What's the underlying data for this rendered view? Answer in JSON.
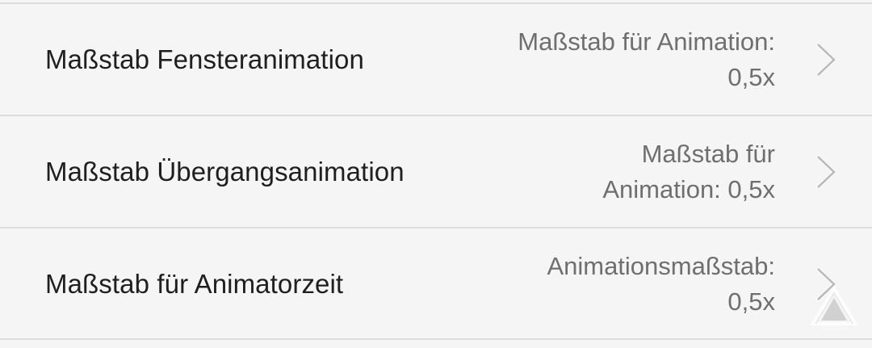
{
  "settings": {
    "items": [
      {
        "title": "Maßstab Fensteranimation",
        "summary_line1": "Maßstab für Animation:",
        "summary_line2": "0,5x"
      },
      {
        "title": "Maßstab Übergangsanimation",
        "summary_line1": "Maßstab für",
        "summary_line2": "Animation: 0,5x"
      },
      {
        "title": "Maßstab für Animatorzeit",
        "summary_line1": "Animationsmaßstab:",
        "summary_line2": "0,5x"
      }
    ]
  },
  "icons": {
    "row_chevron": "chevron-right-icon",
    "watermark": "watermark-logo-icon"
  },
  "colors": {
    "background": "#f5f5f5",
    "title_text": "#1f1f1f",
    "summary_text": "#6f6f6f",
    "divider": "#dcdcdc",
    "chevron": "#b5b5b5"
  }
}
